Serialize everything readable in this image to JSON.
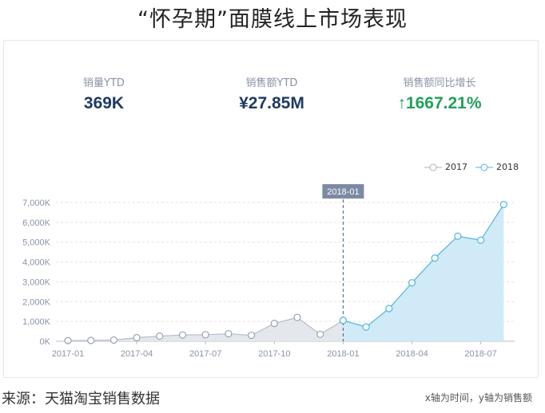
{
  "title": "“怀孕期”面膜线上市场表现",
  "kpis": [
    {
      "label": "销量YTD",
      "value": "369K"
    },
    {
      "label": "销售额YTD",
      "value": "¥27.85M"
    },
    {
      "label": "销售额同比增长",
      "value": "1667.21%",
      "arrow": "↑"
    }
  ],
  "footer": {
    "source": "来源：天猫淘宝销售数据",
    "axis_note": "x轴为时间，y轴为销售额"
  },
  "colors": {
    "series_2017": "#c4c9d2",
    "series_2018": "#4fb6e3",
    "fill_2017": "#e3e7ec",
    "fill_2018": "#cfe9f8",
    "green": "#21a05a",
    "navy": "#1f3a64"
  },
  "chart_data": {
    "type": "area",
    "x": [
      "2017-01",
      "2017-02",
      "2017-03",
      "2017-04",
      "2017-05",
      "2017-06",
      "2017-07",
      "2017-08",
      "2017-09",
      "2017-10",
      "2017-11",
      "2017-12",
      "2018-01",
      "2018-02",
      "2018-03",
      "2018-04",
      "2018-05",
      "2018-06",
      "2018-07",
      "2018-08"
    ],
    "x_ticks": [
      "2017-01",
      "2017-04",
      "2017-07",
      "2017-10",
      "2018-01",
      "2018-04",
      "2018-07"
    ],
    "y_ticks": [
      "0K",
      "1,000K",
      "2,000K",
      "3,000K",
      "4,000K",
      "5,000K",
      "6,000K",
      "7,000K"
    ],
    "ylim": [
      0,
      7000
    ],
    "grid": true,
    "legend_position": "top-right",
    "marker_label": "2018-01",
    "series": [
      {
        "name": "2017",
        "x_start": "2017-01",
        "values": [
          30,
          40,
          60,
          180,
          260,
          320,
          330,
          380,
          300,
          900,
          1200,
          350,
          1050
        ]
      },
      {
        "name": "2018",
        "x_start": "2018-01",
        "values": [
          1050,
          720,
          1650,
          2950,
          4200,
          5300,
          5100,
          6900
        ]
      }
    ]
  }
}
